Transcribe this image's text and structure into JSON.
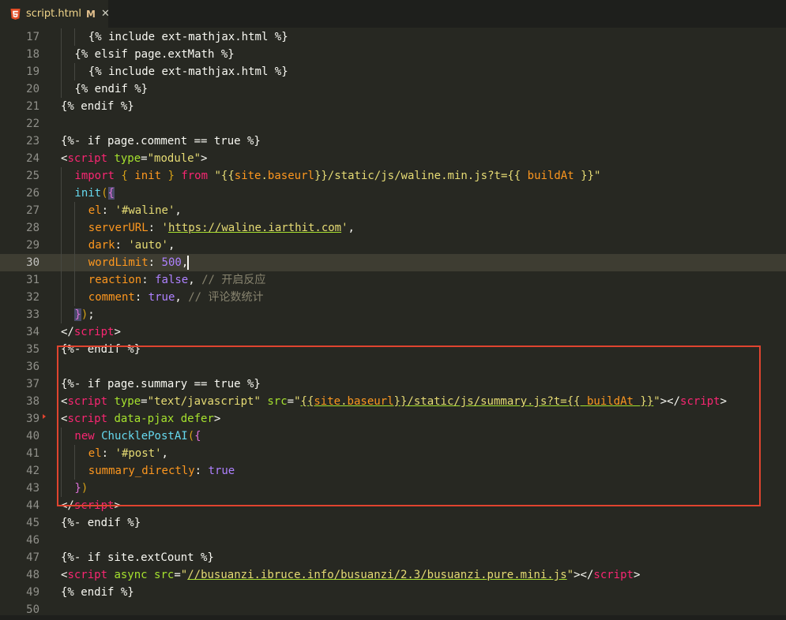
{
  "tab": {
    "filename": "script.html",
    "status": "M",
    "close_glyph": "✕",
    "icon": "html5-icon"
  },
  "lines": [
    {
      "n": "17",
      "indent": 2,
      "tokens": [
        [
          "t-txt",
          "{% include ext-mathjax.html %}"
        ]
      ]
    },
    {
      "n": "18",
      "indent": 1,
      "tokens": [
        [
          "t-txt",
          "{% elsif page.extMath %}"
        ]
      ]
    },
    {
      "n": "19",
      "indent": 2,
      "tokens": [
        [
          "t-txt",
          "{% include ext-mathjax.html %}"
        ]
      ]
    },
    {
      "n": "20",
      "indent": 1,
      "tokens": [
        [
          "t-txt",
          "{% endif %}"
        ]
      ]
    },
    {
      "n": "21",
      "indent": 0,
      "tokens": [
        [
          "t-txt",
          "{% endif %}"
        ]
      ]
    },
    {
      "n": "22",
      "indent": 0,
      "tokens": []
    },
    {
      "n": "23",
      "indent": 0,
      "tokens": [
        [
          "t-txt",
          "{%- if page.comment == true %}"
        ]
      ]
    },
    {
      "n": "24",
      "indent": 0,
      "tokens": [
        [
          "t-txt",
          "<"
        ],
        [
          "t-tag",
          "script"
        ],
        [
          "t-txt",
          " "
        ],
        [
          "t-attr",
          "type"
        ],
        [
          "t-txt",
          "="
        ],
        [
          "t-str",
          "\"module\""
        ],
        [
          "t-txt",
          ">"
        ]
      ]
    },
    {
      "n": "25",
      "indent": 1,
      "tokens": [
        [
          "t-kw",
          "import"
        ],
        [
          "t-txt",
          " "
        ],
        [
          "t-br",
          "{"
        ],
        [
          "t-txt",
          " "
        ],
        [
          "t-var",
          "init"
        ],
        [
          "t-txt",
          " "
        ],
        [
          "t-br",
          "}"
        ],
        [
          "t-txt",
          " "
        ],
        [
          "t-kw",
          "from"
        ],
        [
          "t-txt",
          " "
        ],
        [
          "t-str",
          "\"{{"
        ],
        [
          "t-var",
          "site"
        ],
        [
          "t-str",
          "."
        ],
        [
          "t-var",
          "baseurl"
        ],
        [
          "t-str",
          "}}/static/js/waline.min.js?t={{ "
        ],
        [
          "t-var",
          "buildAt"
        ],
        [
          "t-str",
          " }}\""
        ]
      ]
    },
    {
      "n": "26",
      "indent": 1,
      "tokens": [
        [
          "t-fn",
          "init"
        ],
        [
          "t-br",
          "("
        ],
        [
          "t-br2 bracket-hl",
          "{"
        ]
      ]
    },
    {
      "n": "27",
      "indent": 2,
      "tokens": [
        [
          "t-prop",
          "el"
        ],
        [
          "t-txt",
          ": "
        ],
        [
          "t-str",
          "'#waline'"
        ],
        [
          "t-txt",
          ","
        ]
      ]
    },
    {
      "n": "28",
      "indent": 2,
      "tokens": [
        [
          "t-prop",
          "serverURL"
        ],
        [
          "t-txt",
          ": "
        ],
        [
          "t-str",
          "'"
        ],
        [
          "t-str t-url",
          "https://waline.iarthit.com"
        ],
        [
          "t-str",
          "'"
        ],
        [
          "t-txt",
          ","
        ]
      ]
    },
    {
      "n": "29",
      "indent": 2,
      "tokens": [
        [
          "t-prop",
          "dark"
        ],
        [
          "t-txt",
          ": "
        ],
        [
          "t-str",
          "'auto'"
        ],
        [
          "t-txt",
          ","
        ]
      ]
    },
    {
      "n": "30",
      "indent": 2,
      "current": true,
      "tokens": [
        [
          "t-prop",
          "wordLimit"
        ],
        [
          "t-txt",
          ": "
        ],
        [
          "t-num",
          "500"
        ],
        [
          "t-txt",
          ","
        ]
      ]
    },
    {
      "n": "31",
      "indent": 2,
      "tokens": [
        [
          "t-prop",
          "reaction"
        ],
        [
          "t-txt",
          ": "
        ],
        [
          "t-bool",
          "false"
        ],
        [
          "t-txt",
          ", "
        ],
        [
          "t-cmt",
          "// 开启反应"
        ]
      ]
    },
    {
      "n": "32",
      "indent": 2,
      "tokens": [
        [
          "t-prop",
          "comment"
        ],
        [
          "t-txt",
          ": "
        ],
        [
          "t-bool",
          "true"
        ],
        [
          "t-txt",
          ", "
        ],
        [
          "t-cmt",
          "// 评论数统计"
        ]
      ]
    },
    {
      "n": "33",
      "indent": 1,
      "tokens": [
        [
          "t-br2 bracket-hl",
          "}"
        ],
        [
          "t-br",
          ")"
        ],
        [
          "t-txt",
          ";"
        ]
      ]
    },
    {
      "n": "34",
      "indent": 0,
      "tokens": [
        [
          "t-txt",
          "</"
        ],
        [
          "t-tag",
          "script"
        ],
        [
          "t-txt",
          ">"
        ]
      ]
    },
    {
      "n": "35",
      "indent": 0,
      "tokens": [
        [
          "t-txt",
          "{%- endif %}"
        ]
      ]
    },
    {
      "n": "36",
      "indent": 0,
      "tokens": []
    },
    {
      "n": "37",
      "indent": 0,
      "tokens": [
        [
          "t-txt",
          "{%- if page.summary == true %}"
        ]
      ]
    },
    {
      "n": "38",
      "indent": 0,
      "tokens": [
        [
          "t-txt",
          "<"
        ],
        [
          "t-tag",
          "script"
        ],
        [
          "t-txt",
          " "
        ],
        [
          "t-attr",
          "type"
        ],
        [
          "t-txt",
          "="
        ],
        [
          "t-str",
          "\"text/javascript\""
        ],
        [
          "t-txt",
          " "
        ],
        [
          "t-attr",
          "src"
        ],
        [
          "t-txt",
          "="
        ],
        [
          "t-str",
          "\""
        ],
        [
          "t-str t-url",
          "{{"
        ],
        [
          "t-var t-url",
          "site"
        ],
        [
          "t-str t-url",
          "."
        ],
        [
          "t-var t-url",
          "baseurl"
        ],
        [
          "t-str t-url",
          "}}/static/js/summary.js?t={{ "
        ],
        [
          "t-var t-url",
          "buildAt"
        ],
        [
          "t-str t-url",
          " }}"
        ],
        [
          "t-str",
          "\""
        ],
        [
          "t-txt",
          "></"
        ],
        [
          "t-tag",
          "script"
        ],
        [
          "t-txt",
          ">"
        ]
      ]
    },
    {
      "n": "39",
      "indent": 0,
      "tokens": [
        [
          "t-txt",
          "<"
        ],
        [
          "t-tag",
          "script"
        ],
        [
          "t-txt",
          " "
        ],
        [
          "t-attr",
          "data-pjax"
        ],
        [
          "t-txt",
          " "
        ],
        [
          "t-attr",
          "defer"
        ],
        [
          "t-txt",
          ">"
        ]
      ]
    },
    {
      "n": "40",
      "indent": 1,
      "tokens": [
        [
          "t-kw",
          "new"
        ],
        [
          "t-txt",
          " "
        ],
        [
          "t-fn",
          "ChucklePostAI"
        ],
        [
          "t-br",
          "("
        ],
        [
          "t-br2",
          "{"
        ]
      ]
    },
    {
      "n": "41",
      "indent": 2,
      "tokens": [
        [
          "t-prop",
          "el"
        ],
        [
          "t-txt",
          ": "
        ],
        [
          "t-str",
          "'#post'"
        ],
        [
          "t-txt",
          ","
        ]
      ]
    },
    {
      "n": "42",
      "indent": 2,
      "tokens": [
        [
          "t-prop",
          "summary_directly"
        ],
        [
          "t-txt",
          ": "
        ],
        [
          "t-bool",
          "true"
        ]
      ]
    },
    {
      "n": "43",
      "indent": 1,
      "tokens": [
        [
          "t-br2",
          "}"
        ],
        [
          "t-br",
          ")"
        ]
      ]
    },
    {
      "n": "44",
      "indent": 0,
      "tokens": [
        [
          "t-txt",
          "</"
        ],
        [
          "t-tag",
          "script"
        ],
        [
          "t-txt",
          ">"
        ]
      ]
    },
    {
      "n": "45",
      "indent": 0,
      "tokens": [
        [
          "t-txt",
          "{%- endif %}"
        ]
      ]
    },
    {
      "n": "46",
      "indent": 0,
      "tokens": []
    },
    {
      "n": "47",
      "indent": 0,
      "tokens": [
        [
          "t-txt",
          "{%- if site.extCount %}"
        ]
      ]
    },
    {
      "n": "48",
      "indent": 0,
      "tokens": [
        [
          "t-txt",
          "<"
        ],
        [
          "t-tag",
          "script"
        ],
        [
          "t-txt",
          " "
        ],
        [
          "t-attr",
          "async"
        ],
        [
          "t-txt",
          " "
        ],
        [
          "t-attr",
          "src"
        ],
        [
          "t-txt",
          "="
        ],
        [
          "t-str",
          "\""
        ],
        [
          "t-str t-url",
          "//busuanzi.ibruce.info/busuanzi/2.3/busuanzi.pure.mini.js"
        ],
        [
          "t-str",
          "\""
        ],
        [
          "t-txt",
          "></"
        ],
        [
          "t-tag",
          "script"
        ],
        [
          "t-txt",
          ">"
        ]
      ]
    },
    {
      "n": "49",
      "indent": 0,
      "tokens": [
        [
          "t-txt",
          "{% endif %}"
        ]
      ]
    },
    {
      "n": "50",
      "indent": 0,
      "tokens": []
    }
  ],
  "colors": {
    "background": "#272822",
    "highlight_box": "#e0442f",
    "tab_modified": "#e2c08d"
  }
}
